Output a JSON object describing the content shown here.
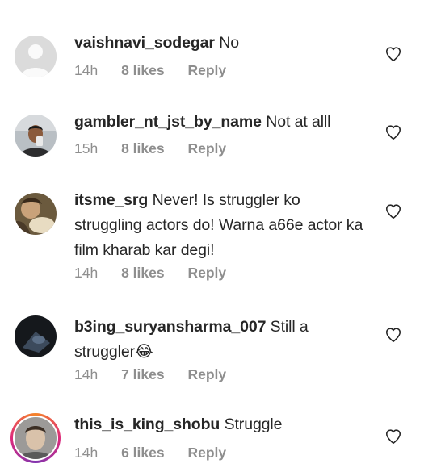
{
  "comments": [
    {
      "username": "vaishnavi_sodegar",
      "text": "No",
      "time": "14h",
      "likes": "8 likes",
      "reply": "Reply"
    },
    {
      "username": "gambler_nt_jst_by_name",
      "text": "Not at alll",
      "time": "15h",
      "likes": "8 likes",
      "reply": "Reply"
    },
    {
      "username": "itsme_srg",
      "text": "Never! Is struggler ko struggling actors do! Warna a66e actor ka film kharab kar degi!",
      "time": "14h",
      "likes": "8 likes",
      "reply": "Reply"
    },
    {
      "username": "b3ing_suryansharma_007",
      "text": "Still a struggler😂",
      "time": "14h",
      "likes": "7 likes",
      "reply": "Reply"
    },
    {
      "username": "this_is_king_shobu",
      "text": "Struggle",
      "time": "14h",
      "likes": "6 likes",
      "reply": "Reply"
    }
  ],
  "icons": {
    "like": "heart-outline-icon"
  },
  "colors": {
    "text": "#262626",
    "meta": "#8e8e8e",
    "story_ring": "#dd2a7b"
  }
}
